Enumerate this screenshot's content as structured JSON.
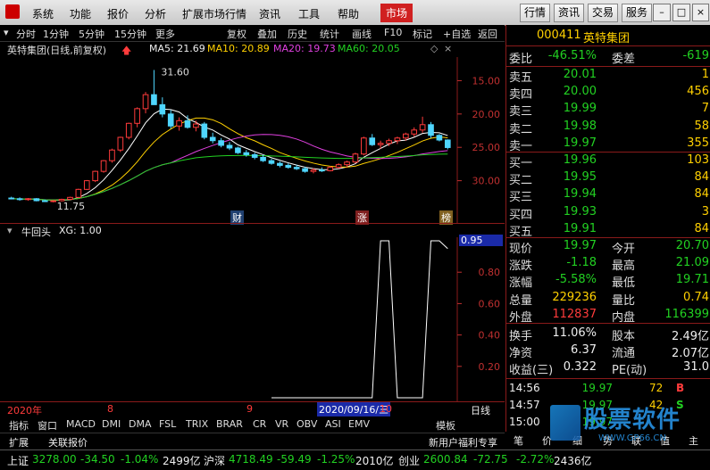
{
  "menubar": {
    "items": [
      "系统",
      "功能",
      "报价",
      "分析",
      "扩展市场行情",
      "资讯",
      "工具",
      "帮助"
    ],
    "active": "市场",
    "right_buttons": [
      "行情",
      "资讯",
      "交易",
      "服务"
    ]
  },
  "chart_toolbar": {
    "periods": [
      "分时",
      "1分钟",
      "5分钟",
      "15分钟",
      "更多"
    ],
    "tools": [
      "复权",
      "叠加",
      "历史",
      "统计",
      "画线",
      "F10",
      "标记",
      "+自选",
      "返回"
    ]
  },
  "main_chart": {
    "stock_label": "英特集团(日线,前复权)",
    "ma5": "MA5: 21.69",
    "ma10": "MA10: 20.89",
    "ma20": "MA20: 19.73",
    "ma60": "MA60: 20.05",
    "high_marker": "31.60",
    "low_marker": "11.75",
    "y_ticks": [
      "30.00",
      "25.00",
      "20.00",
      "15.00"
    ],
    "event_markers": [
      "财",
      "涨",
      "榜"
    ]
  },
  "indicator": {
    "name": "牛回头",
    "params": "XG: 1.00",
    "current": "0.95",
    "y_ticks": [
      "0.80",
      "0.60",
      "0.40",
      "0.20"
    ]
  },
  "date_axis": {
    "year": "2020年",
    "m8": "8",
    "m9": "9",
    "cursor_date": "2020/09/16/三",
    "m10": "10",
    "period": "日线"
  },
  "bottom_tabs": [
    "指标",
    "窗口",
    "MACD",
    "DMI",
    "DMA",
    "FSL",
    "TRIX",
    "BRAR",
    "CR",
    "VR",
    "OBV",
    "ASI",
    "EMV"
  ],
  "bottom_right": {
    "template": "模板",
    "expand": "扩展",
    "quote": "关联报价"
  },
  "promo": "新用户福利专享",
  "quote_panel": {
    "code": "000411",
    "name": "英特集团",
    "weibi_label": "委比",
    "weibi": "-46.51%",
    "weicha_label": "委差",
    "weicha": "-619",
    "asks": [
      {
        "label": "卖五",
        "price": "20.01",
        "vol": "1"
      },
      {
        "label": "卖四",
        "price": "20.00",
        "vol": "456"
      },
      {
        "label": "卖三",
        "price": "19.99",
        "vol": "7"
      },
      {
        "label": "卖二",
        "price": "19.98",
        "vol": "58"
      },
      {
        "label": "卖一",
        "price": "19.97",
        "vol": "355"
      }
    ],
    "bids": [
      {
        "label": "买一",
        "price": "19.96",
        "vol": "103"
      },
      {
        "label": "买二",
        "price": "19.95",
        "vol": "84"
      },
      {
        "label": "买三",
        "price": "19.94",
        "vol": "84"
      },
      {
        "label": "买四",
        "price": "19.93",
        "vol": "3"
      },
      {
        "label": "买五",
        "price": "19.91",
        "vol": "84"
      }
    ],
    "stats": [
      {
        "l1": "现价",
        "v1": "19.97",
        "c1": "green",
        "l2": "今开",
        "v2": "20.70",
        "c2": "green"
      },
      {
        "l1": "涨跌",
        "v1": "-1.18",
        "c1": "green",
        "l2": "最高",
        "v2": "21.09",
        "c2": "green"
      },
      {
        "l1": "涨幅",
        "v1": "-5.58%",
        "c1": "green",
        "l2": "最低",
        "v2": "19.71",
        "c2": "green"
      },
      {
        "l1": "总量",
        "v1": "229236",
        "c1": "yellow",
        "l2": "量比",
        "v2": "0.74",
        "c2": "yellow"
      },
      {
        "l1": "外盘",
        "v1": "112837",
        "c1": "red",
        "l2": "内盘",
        "v2": "116399",
        "c2": "green"
      }
    ],
    "finance": [
      {
        "l1": "换手",
        "v1": "11.06%",
        "l2": "股本",
        "v2": "2.49亿"
      },
      {
        "l1": "净资",
        "v1": "6.37",
        "l2": "流通",
        "v2": "2.07亿"
      },
      {
        "l1": "收益(三)",
        "v1": "0.322",
        "l2": "PE(动)",
        "v2": "31.0"
      }
    ],
    "ticks": [
      {
        "time": "14:56",
        "price": "19.97",
        "vol": "72",
        "side": "B"
      },
      {
        "time": "14:57",
        "price": "19.97",
        "vol": "42",
        "side": "S"
      },
      {
        "time": "15:00",
        "price": "19.97",
        "vol": "",
        "side": ""
      }
    ],
    "tabs": [
      "笔",
      "价",
      "细",
      "势",
      "联",
      "值",
      "主"
    ],
    "watermark": "股票软件",
    "watermark_url": "WWW.GP66.CN"
  },
  "status": {
    "sh_label": "上证",
    "sh_index": "3278.00",
    "sh_chg": "-34.50",
    "sh_pct": "-1.04%",
    "sh_amt": "2499亿",
    "sz_label": "沪深",
    "sz_index": "4718.49",
    "sz_chg": "-59.49",
    "sz_pct": "-1.25%",
    "sz_amt": "2010亿",
    "cy_label": "创业",
    "cy_index": "2600.84",
    "cy_chg": "-72.75",
    "cy_pct": "-2.72%",
    "cy_amt": "2436亿"
  },
  "chart_data": {
    "type": "candlestick",
    "title": "英特集团(日线,前复权)",
    "ylim": [
      10,
      33
    ],
    "yticks": [
      15,
      20,
      25,
      30
    ],
    "candles": [
      [
        12.4,
        12.6,
        12.2,
        12.3
      ],
      [
        12.3,
        12.5,
        12.0,
        12.2
      ],
      [
        12.2,
        12.4,
        12.0,
        12.3
      ],
      [
        12.3,
        12.4,
        11.9,
        12.0
      ],
      [
        12.0,
        12.2,
        11.8,
        11.9
      ],
      [
        11.9,
        12.1,
        11.75,
        12.0
      ],
      [
        12.0,
        12.3,
        11.9,
        12.2
      ],
      [
        12.2,
        12.6,
        12.1,
        12.5
      ],
      [
        12.5,
        13.8,
        12.4,
        13.7
      ],
      [
        13.7,
        15.1,
        13.6,
        15.0
      ],
      [
        15.0,
        16.5,
        14.8,
        16.4
      ],
      [
        16.4,
        18.1,
        16.2,
        18.0
      ],
      [
        18.0,
        19.8,
        17.7,
        19.6
      ],
      [
        19.6,
        21.6,
        19.3,
        21.5
      ],
      [
        21.5,
        23.7,
        21.2,
        23.6
      ],
      [
        23.6,
        26.0,
        23.0,
        25.8
      ],
      [
        25.8,
        28.3,
        25.1,
        27.9
      ],
      [
        27.9,
        31.6,
        27.2,
        26.4
      ],
      [
        26.4,
        27.5,
        24.5,
        25.0
      ],
      [
        25.0,
        25.6,
        22.8,
        23.2
      ],
      [
        23.2,
        24.5,
        22.5,
        24.0
      ],
      [
        24.0,
        24.8,
        22.8,
        23.0
      ],
      [
        23.0,
        24.0,
        22.4,
        23.5
      ],
      [
        23.5,
        23.8,
        21.2,
        21.5
      ],
      [
        21.5,
        22.2,
        20.6,
        21.0
      ],
      [
        21.0,
        21.4,
        20.0,
        20.3
      ],
      [
        20.3,
        20.8,
        19.6,
        19.9
      ],
      [
        19.9,
        20.1,
        19.0,
        19.2
      ],
      [
        19.2,
        19.6,
        18.6,
        18.9
      ],
      [
        18.9,
        19.2,
        18.2,
        18.5
      ],
      [
        18.5,
        18.9,
        17.8,
        18.0
      ],
      [
        18.0,
        18.3,
        17.4,
        17.6
      ],
      [
        17.6,
        17.9,
        17.0,
        17.3
      ],
      [
        17.3,
        17.6,
        16.8,
        17.0
      ],
      [
        17.0,
        17.4,
        16.6,
        16.8
      ],
      [
        16.8,
        17.1,
        16.2,
        16.4
      ],
      [
        16.4,
        16.9,
        16.1,
        16.6
      ],
      [
        16.6,
        17.0,
        16.3,
        16.5
      ],
      [
        16.5,
        17.2,
        16.4,
        17.0
      ],
      [
        17.0,
        17.6,
        16.8,
        17.4
      ],
      [
        17.4,
        18.0,
        17.0,
        17.8
      ],
      [
        17.8,
        19.2,
        17.6,
        19.0
      ],
      [
        19.0,
        21.6,
        18.8,
        21.4
      ],
      [
        21.4,
        22.0,
        20.2,
        20.4
      ],
      [
        20.4,
        21.0,
        19.8,
        20.6
      ],
      [
        20.6,
        21.3,
        20.2,
        21.0
      ],
      [
        21.0,
        21.6,
        20.5,
        21.4
      ],
      [
        21.4,
        22.2,
        21.0,
        22.0
      ],
      [
        22.0,
        23.0,
        21.6,
        22.6
      ],
      [
        22.6,
        24.6,
        22.2,
        23.4
      ],
      [
        23.4,
        23.8,
        21.4,
        21.8
      ],
      [
        21.8,
        22.0,
        20.9,
        21.1
      ],
      [
        21.1,
        21.2,
        19.7,
        19.97
      ]
    ],
    "indicator_xg": [
      0,
      0,
      0,
      0,
      0,
      0,
      0,
      0,
      0,
      0,
      0,
      0,
      0,
      0,
      0,
      0,
      0,
      0,
      0,
      0,
      0,
      0,
      0,
      0,
      0,
      0,
      0,
      0,
      0,
      0,
      0,
      0,
      0,
      0,
      0,
      0,
      0,
      0,
      0,
      0,
      0,
      0,
      0,
      0,
      1,
      1,
      0,
      0,
      0,
      0,
      1,
      1,
      0.95
    ]
  }
}
